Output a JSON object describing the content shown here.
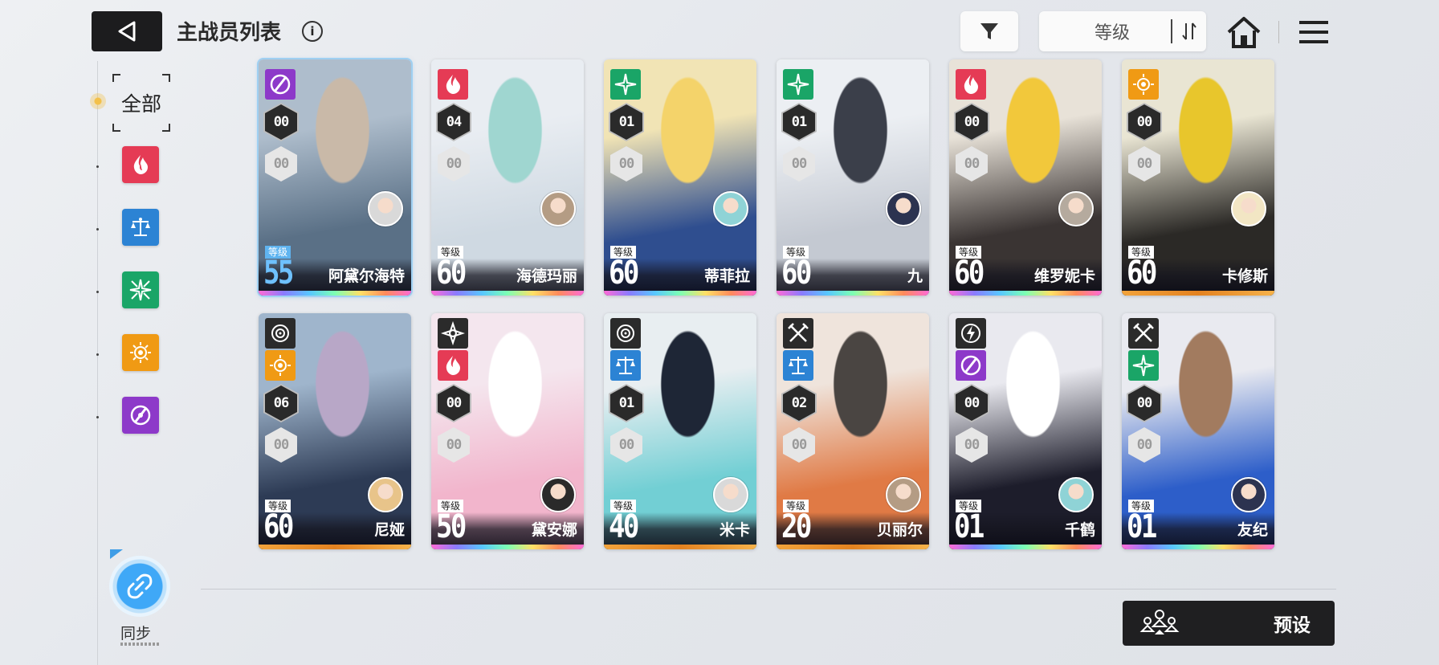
{
  "header": {
    "title": "主战员列表",
    "info_glyph": "i",
    "sort_label": "等级"
  },
  "sidebar": {
    "all_label": "全部",
    "elements": [
      "fire",
      "water",
      "wind",
      "iron",
      "electric"
    ],
    "sync_label": "同步"
  },
  "colors": {
    "fire": "#e53b55",
    "water": "#2c83d4",
    "wind": "#1aa567",
    "iron": "#f09a14",
    "electric": "#8d39c9"
  },
  "level_tag": "等级",
  "cards": [
    {
      "name": "阿黛尔海特",
      "level": "55",
      "element": "electric",
      "limit": "00",
      "core": "00",
      "selected": true
    },
    {
      "name": "海德玛丽",
      "level": "60",
      "element": "fire",
      "limit": "04",
      "core": "00"
    },
    {
      "name": "蒂菲拉",
      "level": "60",
      "element": "wind",
      "limit": "01",
      "core": "00"
    },
    {
      "name": "九",
      "level": "60",
      "element": "wind",
      "limit": "01",
      "core": "00"
    },
    {
      "name": "维罗妮卡",
      "level": "60",
      "element": "fire",
      "limit": "00",
      "core": "00"
    },
    {
      "name": "卡修斯",
      "level": "60",
      "element": "iron",
      "limit": "00",
      "core": "00"
    },
    {
      "name": "尼娅",
      "level": "60",
      "element": "iron",
      "class": "target",
      "limit": "06",
      "core": "00"
    },
    {
      "name": "黛安娜",
      "level": "50",
      "element": "fire",
      "class": "compass",
      "limit": "00",
      "core": "00"
    },
    {
      "name": "米卡",
      "level": "40",
      "element": "water",
      "class": "target",
      "limit": "01",
      "core": "00"
    },
    {
      "name": "贝丽尔",
      "level": "20",
      "element": "water",
      "class": "swords",
      "limit": "02",
      "core": "00"
    },
    {
      "name": "千鹤",
      "level": "01",
      "element": "electric",
      "class": "lightning",
      "limit": "00",
      "core": "00"
    },
    {
      "name": "友纪",
      "level": "01",
      "element": "wind",
      "class": "swords",
      "limit": "00",
      "core": "00"
    }
  ],
  "footer": {
    "preset_label": "预设"
  }
}
